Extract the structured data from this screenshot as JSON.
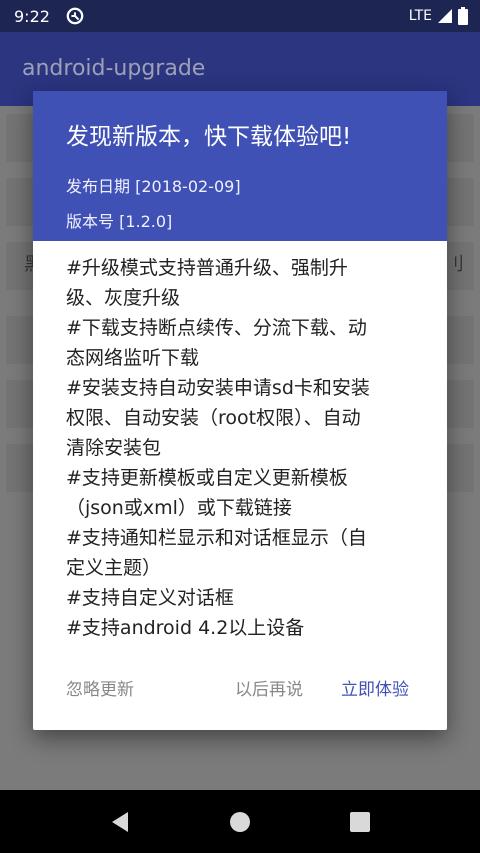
{
  "status_bar": {
    "time": "9:22",
    "network": "LTE"
  },
  "app_bar": {
    "title": "android-upgrade"
  },
  "background": {
    "partial_left": "黑",
    "partial_right": "刂"
  },
  "dialog": {
    "title": "发现新版本，快下载体验吧!",
    "release_date": "发布日期 [2018-02-09]",
    "version": "版本号 [1.2.0]",
    "body_lines": [
      "#升级模式支持普通升级、强制升",
      "级、灰度升级",
      "#下载支持断点续传、分流下载、动",
      "态网络监听下载",
      "#安装支持自动安装申请sd卡和安装",
      "权限、自动安装（root权限）、自动",
      "清除安装包",
      "#支持更新模板或自定义更新模板",
      "（json或xml）或下载链接",
      "#支持通知栏显示和对话框显示（自",
      "定义主题）",
      "#支持自定义对话框",
      "#支持android 4.2以上设备"
    ],
    "buttons": {
      "ignore": "忽略更新",
      "later": "以后再说",
      "now": "立即体验"
    }
  },
  "colors": {
    "primary": "#3f51b5",
    "primary_dark": "#1d2553",
    "app_bar_dimmed": "#2b3580"
  }
}
